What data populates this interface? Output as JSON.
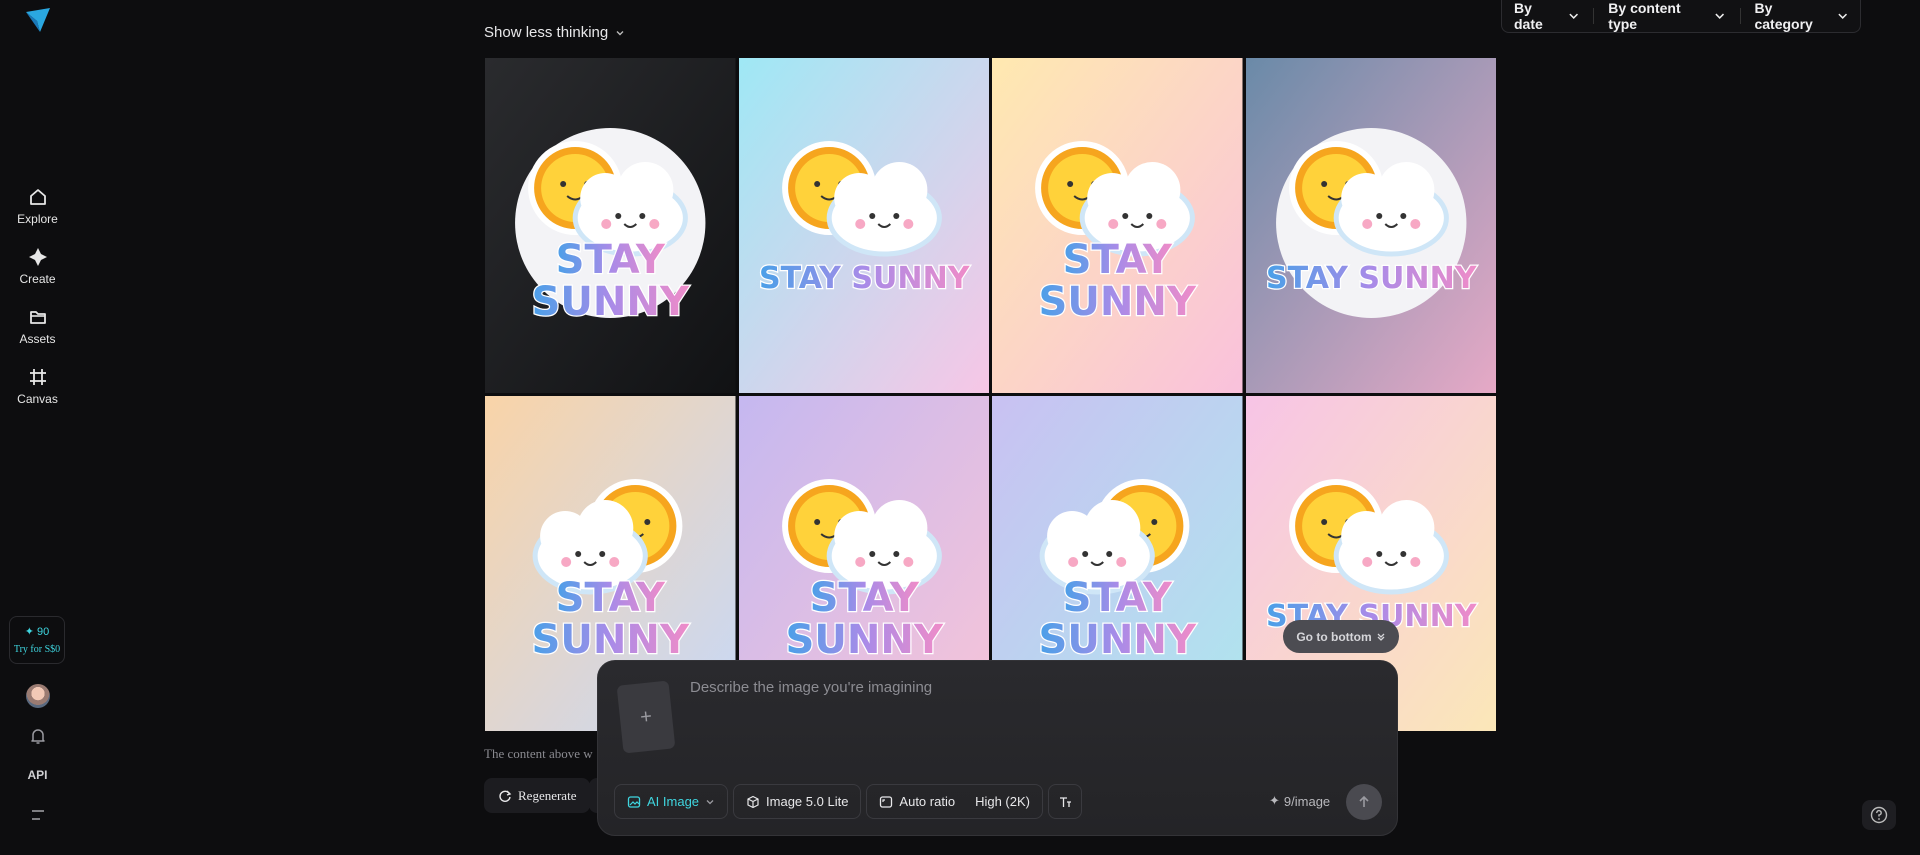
{
  "sidebar": {
    "items": [
      {
        "label": "Explore"
      },
      {
        "label": "Create"
      },
      {
        "label": "Assets"
      },
      {
        "label": "Canvas"
      }
    ],
    "credits": {
      "amount": "90",
      "try_label": "Try for S$0"
    },
    "api_label": "API"
  },
  "thread": {
    "thinking_toggle": "Show less thinking",
    "disclaimer": "The content above w",
    "regenerate_label": "Regenerate"
  },
  "filters": [
    {
      "label": "By date"
    },
    {
      "label": "By content type"
    },
    {
      "label": "By category"
    }
  ],
  "results": {
    "sticker_text": "STAY SUNNY",
    "tiles": [
      {
        "line1": "STAY",
        "line2": "SUNNY"
      },
      {
        "line1": "STAY SUNNY",
        "line2": ""
      },
      {
        "line1": "STAY",
        "line2": "SUNNY"
      },
      {
        "line1": "STAY SUNNY",
        "line2": ""
      },
      {
        "line1": "STAY",
        "line2": "SUNNY"
      },
      {
        "line1": "STAY",
        "line2": "SUNNY"
      },
      {
        "line1": "STAY",
        "line2": "SUNNY"
      },
      {
        "line1": "STAY SUNNY",
        "line2": ""
      }
    ]
  },
  "go_to_bottom": "Go to bottom",
  "composer": {
    "placeholder": "Describe the image you're imagining",
    "mode": "AI Image",
    "model": "Image 5.0 Lite",
    "ratio": "Auto ratio",
    "quality": "High (2K)",
    "cost": "9/image"
  },
  "colors": {
    "accent": "#3fd6e0",
    "background": "#0d0d0f",
    "composer": "#2a2a2e"
  }
}
